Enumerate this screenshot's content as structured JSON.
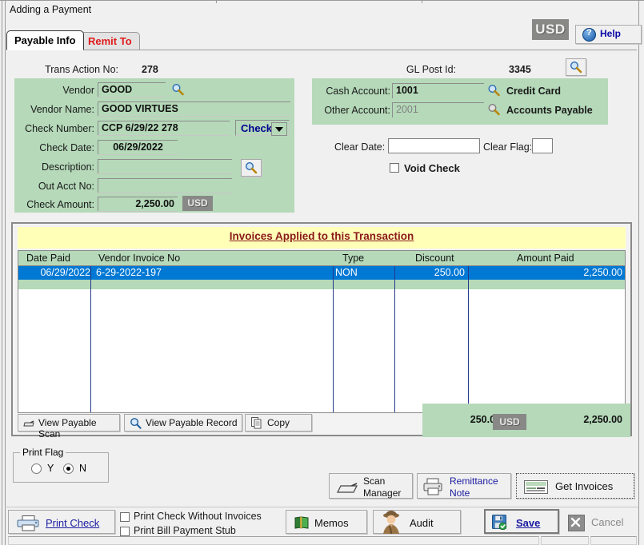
{
  "window": {
    "title": "Adding a Payment"
  },
  "tabs": [
    {
      "label": "Payable Info",
      "active": true
    },
    {
      "label": "Remit To",
      "active": false
    }
  ],
  "header": {
    "currency_badge": "USD",
    "help_label": "Help",
    "help_icon": "question-circle-icon"
  },
  "form": {
    "trans_action_no_label": "Trans Action No:",
    "trans_action_no_value": "278",
    "gl_post_id_label": "GL Post Id:",
    "gl_post_id_value": "3345",
    "vendor_label": "Vendor",
    "vendor_value": "GOOD",
    "vendor_name_label": "Vendor Name:",
    "vendor_name_value": "GOOD VIRTUES",
    "check_number_label": "Check Number:",
    "check_number_value": "CCP  6/29/22 278",
    "check_type_value": "Check",
    "check_date_label": "Check Date:",
    "check_date_value": "06/29/2022",
    "description_label": "Description:",
    "description_value": "",
    "out_acct_no_label": "Out Acct No:",
    "out_acct_no_value": "",
    "check_amount_label": "Check Amount:",
    "check_amount_value": "2,250.00",
    "check_amount_currency": "USD",
    "cash_account_label": "Cash Account:",
    "cash_account_value": "1001",
    "cash_account_name": "Credit Card",
    "other_account_label": "Other Account:",
    "other_account_value": "2001",
    "other_account_name": "Accounts Payable",
    "clear_date_label": "Clear Date:",
    "clear_date_value": "",
    "clear_flag_label": "Clear Flag:",
    "clear_flag_value": "",
    "void_check_label": "Void Check",
    "void_check_checked": false
  },
  "invoices": {
    "banner": "Invoices Applied to this Transaction",
    "columns": [
      "Date Paid",
      "Vendor Invoice No",
      "Type",
      "Discount",
      "Amount Paid"
    ],
    "rows": [
      {
        "date_paid": "06/29/2022",
        "vendor_invoice_no": "6-29-2022-197",
        "type": "NON",
        "discount": "250.00",
        "amount_paid": "2,250.00",
        "selected": true
      }
    ],
    "totals": {
      "discount": "250.00",
      "currency": "USD",
      "amount_paid": "2,250.00"
    },
    "buttons": [
      {
        "label": "View Payable Scan",
        "icon": "scanner-icon"
      },
      {
        "label": "View Payable Record",
        "icon": "magnifier-icon"
      },
      {
        "label": "Copy",
        "icon": "copy-icon"
      }
    ]
  },
  "print_flag": {
    "caption": "Print Flag",
    "options": [
      {
        "label": "Y",
        "selected": false
      },
      {
        "label": "N",
        "selected": true
      }
    ]
  },
  "action_buttons": {
    "scan_manager_line1": "Scan",
    "scan_manager_line2": "Manager",
    "remittance_line1": "Remittance",
    "remittance_line2": "Note",
    "get_invoices": "Get Invoices"
  },
  "footer": {
    "print_check": "Print Check",
    "print_check_without_invoices": "Print Check Without Invoices",
    "print_check_without_invoices_checked": false,
    "print_bill_payment_stub": "Print Bill Payment Stub",
    "print_bill_payment_stub_checked": false,
    "memos": "Memos",
    "audit": "Audit",
    "save": "Save",
    "cancel": "Cancel"
  },
  "colors": {
    "panel_green": "#b5d9b9",
    "banner_yellow": "#ffffb8",
    "selection_blue": "#0078d4",
    "banner_text": "#8b1a1a",
    "link_blue": "#000090",
    "tab_inactive_text": "#e01b1b"
  }
}
